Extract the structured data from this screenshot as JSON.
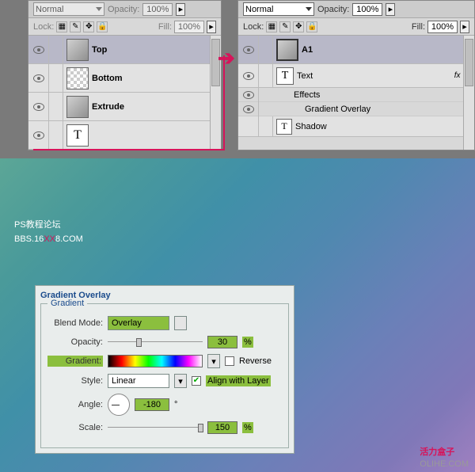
{
  "left_panel": {
    "blend_mode": "Normal",
    "opacity_label": "Opacity:",
    "opacity_value": "100%",
    "lock_label": "Lock:",
    "fill_label": "Fill:",
    "fill_value": "100%",
    "layers": [
      {
        "name": "Top"
      },
      {
        "name": "Bottom"
      },
      {
        "name": "Extrude"
      }
    ]
  },
  "right_panel": {
    "blend_mode": "Normal",
    "opacity_label": "Opacity:",
    "opacity_value": "100%",
    "lock_label": "Lock:",
    "fill_label": "Fill:",
    "fill_value": "100%",
    "layers": [
      {
        "name": "A1"
      },
      {
        "name": "Text",
        "fx": "fx"
      }
    ],
    "effects_label": "Effects",
    "effect_item": "Gradient Overlay",
    "extra_layer": "Shadow"
  },
  "watermark": {
    "line1": "PS教程论坛",
    "line2a": "BBS.16",
    "line2b": "XX",
    "line2c": "8.COM"
  },
  "dialog": {
    "title": "Gradient Overlay",
    "legend": "Gradient",
    "blend_label": "Blend Mode:",
    "blend_value": "Overlay",
    "opacity_label": "Opacity:",
    "opacity_value": "30",
    "pct": "%",
    "gradient_label": "Gradient:",
    "reverse_label": "Reverse",
    "style_label": "Style:",
    "style_value": "Linear",
    "align_label": "Align with Layer",
    "angle_label": "Angle:",
    "angle_value": "-180",
    "deg": "°",
    "scale_label": "Scale:",
    "scale_value": "150"
  },
  "footer": {
    "cn": "活力盒子",
    "en": "OLIHE.COM"
  }
}
